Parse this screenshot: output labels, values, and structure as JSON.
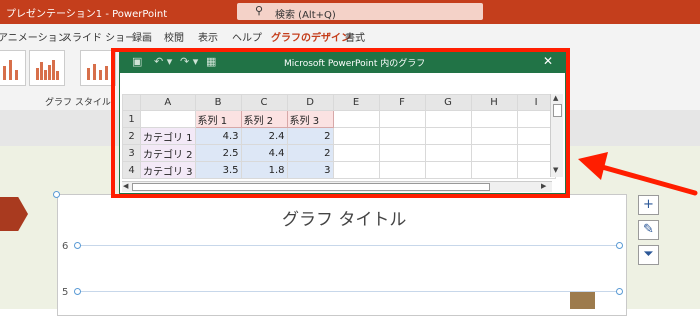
{
  "titlebar": {
    "app_title": "プレゼンテーション1 - PowerPoint"
  },
  "search": {
    "icon": "search-icon",
    "text": "検索 (Alt+Q)"
  },
  "ribbon_tabs": [
    {
      "label": "アニメーション",
      "active": false
    },
    {
      "label": "スライド ショー",
      "active": false
    },
    {
      "label": "録画",
      "active": false
    },
    {
      "label": "校閲",
      "active": false
    },
    {
      "label": "表示",
      "active": false
    },
    {
      "label": "ヘルプ",
      "active": false
    },
    {
      "label": "グラフのデザイン",
      "active": true
    },
    {
      "label": "書式",
      "active": false
    }
  ],
  "ribbon": {
    "group_label": "グラフ スタイル"
  },
  "excel_window": {
    "title": "Microsoft PowerPoint 内のグラフ",
    "quick_access": [
      "save-icon",
      "undo-icon",
      "redo-icon",
      "edit-data-icon"
    ],
    "close_icon": "close-icon",
    "columns": [
      "A",
      "B",
      "C",
      "D",
      "E",
      "F",
      "G",
      "H",
      "I"
    ],
    "rows": [
      {
        "num": "1",
        "cells": [
          "",
          "系列 1",
          "系列 2",
          "系列 3",
          "",
          "",
          "",
          "",
          ""
        ]
      },
      {
        "num": "2",
        "cells": [
          "カテゴリ 1",
          "4.3",
          "2.4",
          "2",
          "",
          "",
          "",
          "",
          ""
        ]
      },
      {
        "num": "3",
        "cells": [
          "カテゴリ 2",
          "2.5",
          "4.4",
          "2",
          "",
          "",
          "",
          "",
          ""
        ]
      },
      {
        "num": "4",
        "cells": [
          "カテゴリ 3",
          "3.5",
          "1.8",
          "3",
          "",
          "",
          "",
          "",
          ""
        ]
      }
    ]
  },
  "slide": {
    "chart_title": "グラフ タイトル",
    "y_axis_labels": [
      "6",
      "5"
    ]
  },
  "side_buttons": [
    "plus-icon",
    "brush-icon",
    "filter-icon"
  ],
  "annotation": {
    "color": "#ff1e00",
    "arrow_icon": "arrow-icon"
  }
}
